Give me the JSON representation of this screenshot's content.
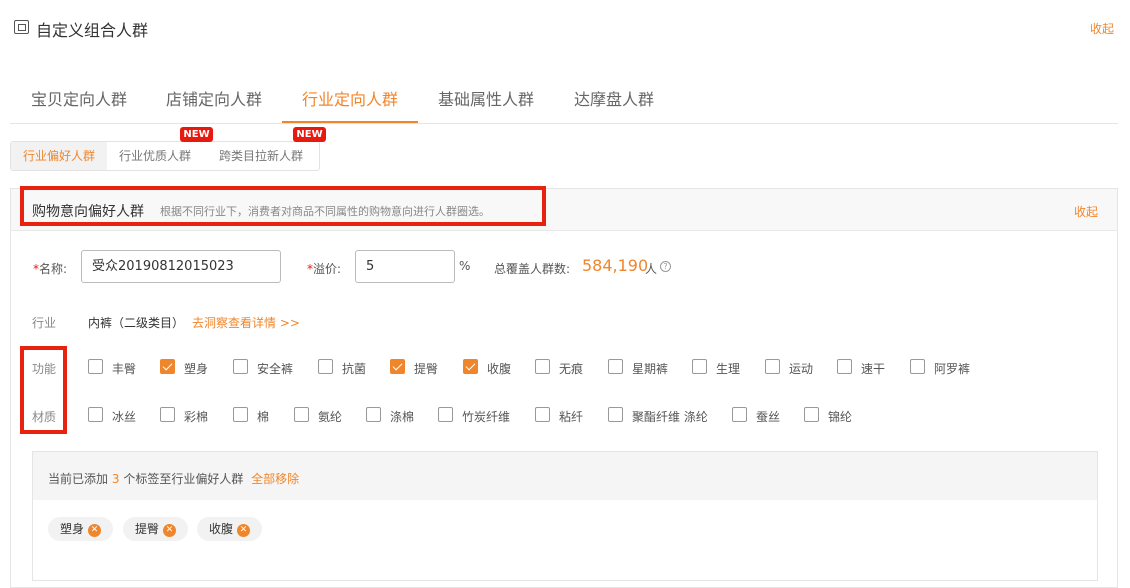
{
  "header": {
    "title": "自定义组合人群",
    "collapse": "收起"
  },
  "tabs": [
    "宝贝定向人群",
    "店铺定向人群",
    "行业定向人群",
    "基础属性人群",
    "达摩盘人群"
  ],
  "subtabs": [
    "行业偏好人群",
    "行业优质人群",
    "跨类目拉新人群"
  ],
  "new_badge": "NEW",
  "panel": {
    "title": "购物意向偏好人群",
    "desc": "根据不同行业下，消费者对商品不同属性的购物意向进行人群圈选。",
    "collapse": "收起"
  },
  "form": {
    "req": "*",
    "name_label": "名称:",
    "name_value": "受众20190812015023",
    "premium_label": "溢价:",
    "premium_value": "5",
    "percent": "%",
    "coverage_label": "总覆盖人群数:",
    "coverage_value": "584,190",
    "coverage_unit": "人",
    "help": "?"
  },
  "industry": {
    "label": "行业",
    "value": "内裤（二级类目）",
    "link": "去洞察查看详情 >>"
  },
  "function": {
    "label": "功能",
    "options": [
      {
        "t": "丰臀",
        "c": false
      },
      {
        "t": "塑身",
        "c": true
      },
      {
        "t": "安全裤",
        "c": false
      },
      {
        "t": "抗菌",
        "c": false
      },
      {
        "t": "提臀",
        "c": true
      },
      {
        "t": "收腹",
        "c": true
      },
      {
        "t": "无痕",
        "c": false
      },
      {
        "t": "星期裤",
        "c": false
      },
      {
        "t": "生理",
        "c": false
      },
      {
        "t": "运动",
        "c": false
      },
      {
        "t": "速干",
        "c": false
      },
      {
        "t": "阿罗裤",
        "c": false
      }
    ]
  },
  "material": {
    "label": "材质",
    "options": [
      {
        "t": "冰丝",
        "c": false
      },
      {
        "t": "彩棉",
        "c": false
      },
      {
        "t": "棉",
        "c": false
      },
      {
        "t": "氨纶",
        "c": false
      },
      {
        "t": "涤棉",
        "c": false
      },
      {
        "t": "竹炭纤维",
        "c": false
      },
      {
        "t": "粘纤",
        "c": false
      },
      {
        "t": "聚酯纤维 涤纶",
        "c": false
      },
      {
        "t": "蚕丝",
        "c": false
      },
      {
        "t": "锦纶",
        "c": false
      }
    ]
  },
  "selected": {
    "prefix": "当前已添加",
    "count": "3",
    "suffix": "个标签至行业偏好人群",
    "remove_all": "全部移除",
    "chips": [
      "塑身",
      "提臀",
      "收腹"
    ],
    "x": "✕"
  },
  "colors": {
    "accent": "#f0862b",
    "highlight": "#e8220f"
  }
}
